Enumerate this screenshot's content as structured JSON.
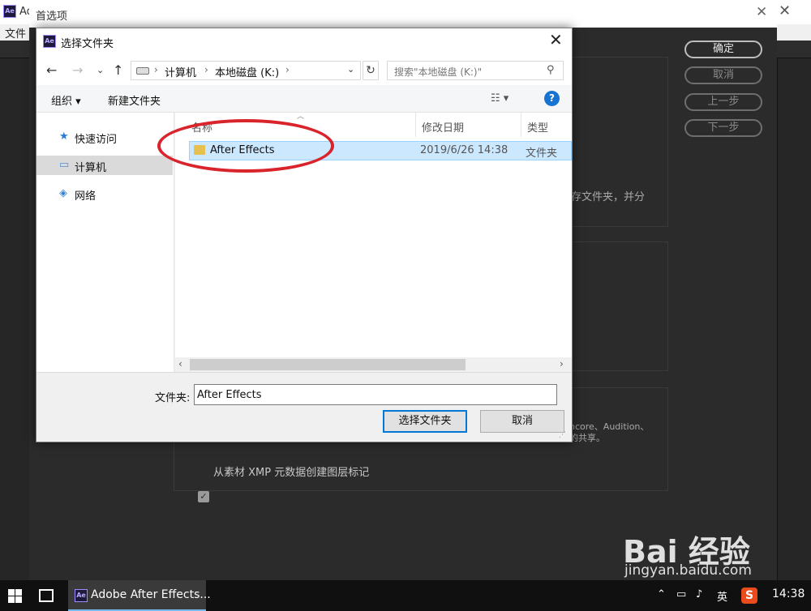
{
  "ae": {
    "logo": "Ae",
    "window_title": "Ad",
    "menu_first": "文件"
  },
  "preferences": {
    "title": "首选项",
    "buttons": [
      "确定",
      "取消",
      "上一步",
      "下一步"
    ],
    "text_fragment_1": "存文件夹，并分",
    "text_fragment_2": "ncore、Audition、",
    "text_fragment_3": "的共享。",
    "checkbox_label": "从素材 XMP 元数据创建图层标记",
    "checkbox_checked": true
  },
  "dialog": {
    "title": "选择文件夹",
    "address": {
      "segments": [
        "计算机",
        "本地磁盘 (K:)"
      ]
    },
    "search_placeholder": "搜索\"本地磁盘 (K:)\"",
    "toolbar": {
      "organize": "组织 ▾",
      "new_folder": "新建文件夹",
      "help": "?"
    },
    "nav_items": [
      {
        "label": "快速访问",
        "icon": "star-icon"
      },
      {
        "label": "计算机",
        "icon": "computer-icon",
        "selected": true
      },
      {
        "label": "网络",
        "icon": "network-icon"
      }
    ],
    "columns": [
      "名称",
      "修改日期",
      "类型"
    ],
    "files": [
      {
        "name": "After Effects",
        "date": "2019/6/26 14:38",
        "type": "文件夹",
        "selected": true
      }
    ],
    "folder_label": "文件夹:",
    "folder_value": "After Effects",
    "select_button": "选择文件夹",
    "cancel_button": "取消"
  },
  "taskbar": {
    "app_label": "Adobe After Effects...",
    "ime": "英",
    "time": "14:38"
  },
  "watermark": {
    "main": "Bai 经验",
    "sub": "jingyan.baidu.com"
  },
  "colors": {
    "selection": "#cce8ff",
    "annotation": "#d8242a",
    "help": "#1673d2"
  }
}
